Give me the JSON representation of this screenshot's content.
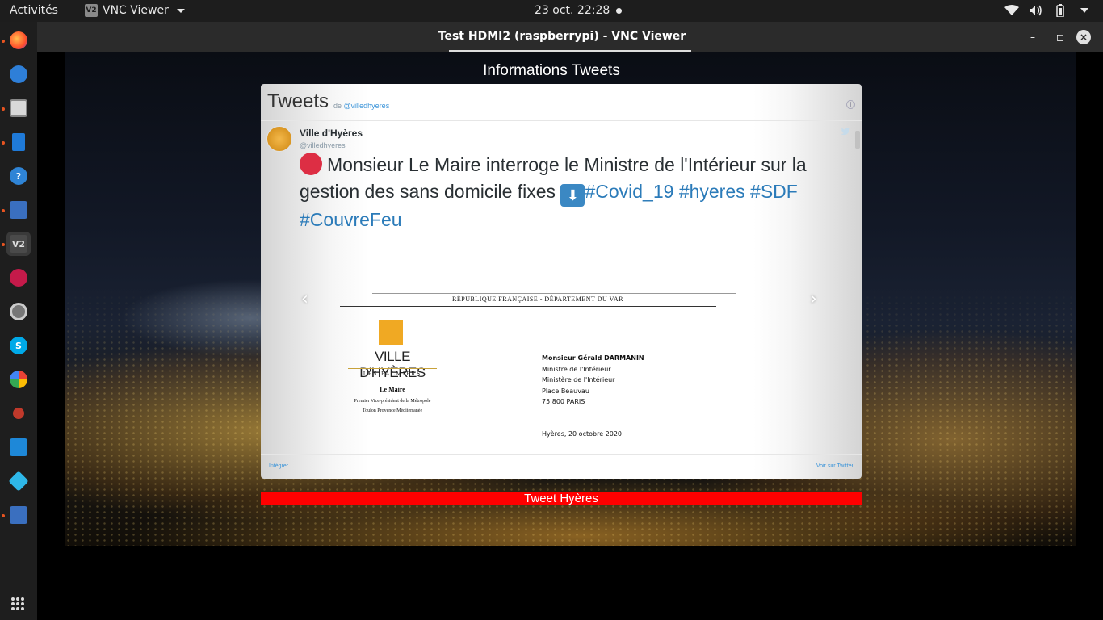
{
  "topbar": {
    "activities": "Activités",
    "app_name": "VNC Viewer",
    "app_icon_text": "V2",
    "clock": "23 oct.  22:28"
  },
  "window": {
    "title": "Test HDMI2 (raspberrypi) - VNC Viewer"
  },
  "page": {
    "heading": "Informations Tweets",
    "footer_bar": "Tweet Hyères"
  },
  "widget": {
    "title": "Tweets",
    "by_prefix": "de",
    "by_handle": "@villedhyeres",
    "footer_left": "Intégrer",
    "footer_right": "Voir sur Twitter"
  },
  "tweet": {
    "author_name": "Ville d'Hyères",
    "author_handle": "@villedhyeres",
    "text": "Monsieur Le Maire interroge le Ministre de l'Intérieur sur la gestion des sans domicile fixes",
    "hashtags": [
      "#Covid_19",
      "#hyeres",
      "#SDF",
      "#CouvreFeu"
    ]
  },
  "letter": {
    "header": "RÉPUBLIQUE FRANÇAISE - DÉPARTEMENT DU VAR",
    "logo": "VILLE D'HYÈRES",
    "logo_sub": "LES PALMIERS",
    "maire": "Le Maire",
    "maire_sub_1": "Premier Vice-président de la Métropole",
    "maire_sub_2": "Toulon Provence Méditerranée",
    "recipient": "Monsieur Gérald DARMANIN",
    "addr_1": "Ministre de l'Intérieur",
    "addr_2": "Ministère de l'Intérieur",
    "addr_3": "Place Beauvau",
    "addr_4": "75 800 PARIS",
    "date": "Hyères, 20 octobre 2020"
  },
  "colors": {
    "hashtag": "#2b7bb9",
    "tweet_bar": "#ff0000",
    "dock_dot": "#e95420"
  },
  "dock": {
    "icons": [
      "firefox-icon",
      "thunderbird-icon",
      "files-icon",
      "writer-icon",
      "help-icon",
      "remote-access-icon",
      "vnc-viewer-icon",
      "raspberry-pi-icon",
      "settings-icon",
      "skype-icon",
      "pinwheel-icon",
      "joystick-icon",
      "vscode-icon",
      "kodi-icon",
      "remote-access-2-icon",
      "show-apps-icon"
    ]
  }
}
